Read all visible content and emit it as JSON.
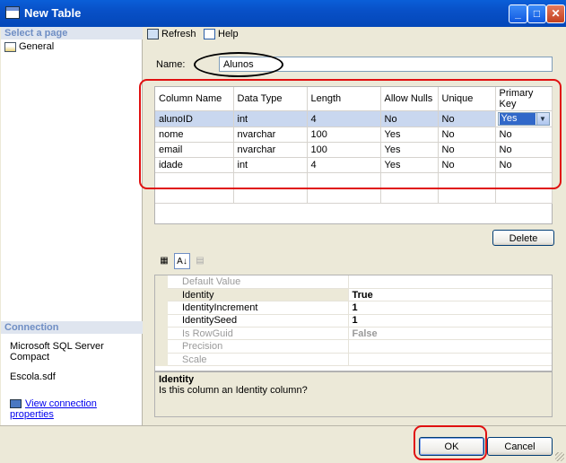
{
  "window": {
    "title": "New Table"
  },
  "left": {
    "select_page_header": "Select a page",
    "pages": [
      {
        "label": "General"
      }
    ],
    "connection_header": "Connection",
    "server": "Microsoft SQL Server Compact",
    "database": "Escola.sdf",
    "view_props_link": "View connection properties"
  },
  "toolbar": {
    "refresh": "Refresh",
    "help": "Help"
  },
  "form": {
    "name_label": "Name:",
    "name_value": "Alunos"
  },
  "grid": {
    "headers": [
      "Column Name",
      "Data Type",
      "Length",
      "Allow Nulls",
      "Unique",
      "Primary Key"
    ],
    "rows": [
      [
        "alunoID",
        "int",
        "4",
        "No",
        "No",
        "Yes"
      ],
      [
        "nome",
        "nvarchar",
        "100",
        "Yes",
        "No",
        "No"
      ],
      [
        "email",
        "nvarchar",
        "100",
        "Yes",
        "No",
        "No"
      ],
      [
        "idade",
        "int",
        "4",
        "Yes",
        "No",
        "No"
      ]
    ]
  },
  "delete_button": "Delete",
  "properties": [
    {
      "name": "Default Value",
      "value": "",
      "disabled": true
    },
    {
      "name": "Identity",
      "value": "True",
      "disabled": false
    },
    {
      "name": "IdentityIncrement",
      "value": "1",
      "disabled": false
    },
    {
      "name": "IdentitySeed",
      "value": "1",
      "disabled": false
    },
    {
      "name": "Is RowGuid",
      "value": "False",
      "disabled": true
    },
    {
      "name": "Precision",
      "value": "",
      "disabled": true
    },
    {
      "name": "Scale",
      "value": "",
      "disabled": true
    }
  ],
  "description": {
    "title": "Identity",
    "text": "Is this column an Identity column?"
  },
  "buttons": {
    "ok": "OK",
    "cancel": "Cancel"
  },
  "colors": {
    "title_bar": "#0a5fd8",
    "highlight_red": "#e01010",
    "selected_row": "#c9d7ef"
  }
}
